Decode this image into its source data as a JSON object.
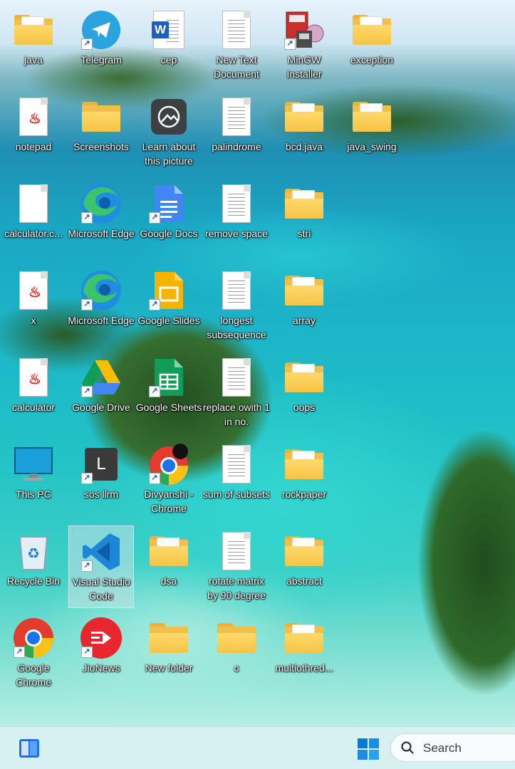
{
  "desktop": {
    "icons": [
      {
        "label": "java",
        "kind": "folder"
      },
      {
        "label": "Telegram",
        "kind": "telegram-icon",
        "shortcut": true
      },
      {
        "label": "cep",
        "kind": "word-icon"
      },
      {
        "label": "New Text Document",
        "kind": "text-doc"
      },
      {
        "label": "MinGW Installer",
        "kind": "mingw-icon",
        "shortcut": true
      },
      {
        "label": "exception",
        "kind": "folder"
      },
      {
        "label": "notepad",
        "kind": "java-file"
      },
      {
        "label": "Screenshots",
        "kind": "folder-plain"
      },
      {
        "label": "Learn about this picture",
        "kind": "learn-icon"
      },
      {
        "label": "palindrome",
        "kind": "text-doc"
      },
      {
        "label": "bcd.java",
        "kind": "folder"
      },
      {
        "label": "java_swing",
        "kind": "folder"
      },
      {
        "label": "calculator.c...",
        "kind": "blank-file"
      },
      {
        "label": "Microsoft Edge",
        "kind": "edge-icon",
        "shortcut": true
      },
      {
        "label": "Google Docs",
        "kind": "docs-icon",
        "shortcut": true
      },
      {
        "label": "remove space",
        "kind": "text-doc"
      },
      {
        "label": "stri",
        "kind": "folder"
      },
      {
        "label": "x",
        "kind": "java-file"
      },
      {
        "label": "Microsoft Edge",
        "kind": "edge-icon",
        "shortcut": true
      },
      {
        "label": "Google Slides",
        "kind": "slides-icon",
        "shortcut": true
      },
      {
        "label": "longest subsequence",
        "kind": "text-doc"
      },
      {
        "label": "array",
        "kind": "folder"
      },
      {
        "label": "calculator",
        "kind": "java-file"
      },
      {
        "label": "Google Drive",
        "kind": "drive-icon",
        "shortcut": true
      },
      {
        "label": "Google Sheets",
        "kind": "sheets-icon",
        "shortcut": true
      },
      {
        "label": "replace owith 1 in no.",
        "kind": "text-doc"
      },
      {
        "label": "oops",
        "kind": "folder"
      },
      {
        "label": "This PC",
        "kind": "pc-icon"
      },
      {
        "label": "sos llrm",
        "kind": "sos-icon",
        "shortcut": true,
        "letter": "L"
      },
      {
        "label": "Divyanshi - Chrome",
        "kind": "chrome-icon",
        "shortcut": true
      },
      {
        "label": "sum of subsets",
        "kind": "text-doc"
      },
      {
        "label": "rockpaper",
        "kind": "folder"
      },
      {
        "label": "Recycle Bin",
        "kind": "recycle-icon"
      },
      {
        "label": "Visual Studio Code",
        "kind": "vscode-icon",
        "shortcut": true,
        "selected": true
      },
      {
        "label": "dsa",
        "kind": "folder"
      },
      {
        "label": "rotate matrix by 90 degree",
        "kind": "text-doc"
      },
      {
        "label": "abstract",
        "kind": "folder"
      },
      {
        "label": "Google Chrome",
        "kind": "chrome-icon",
        "shortcut": true
      },
      {
        "label": "JioNews",
        "kind": "jionews-icon",
        "shortcut": true
      },
      {
        "label": "New folder",
        "kind": "folder-plain"
      },
      {
        "label": "c",
        "kind": "folder-plain"
      },
      {
        "label": "multiothred...",
        "kind": "folder"
      }
    ]
  },
  "taskbar": {
    "search_placeholder": "Search",
    "widgets_icon": "widgets-icon",
    "start_icon": "windows-start-icon"
  },
  "colors": {
    "folder": "#f5c447",
    "taskbar": "#d6f1ef",
    "label_text": "#ffffff"
  }
}
